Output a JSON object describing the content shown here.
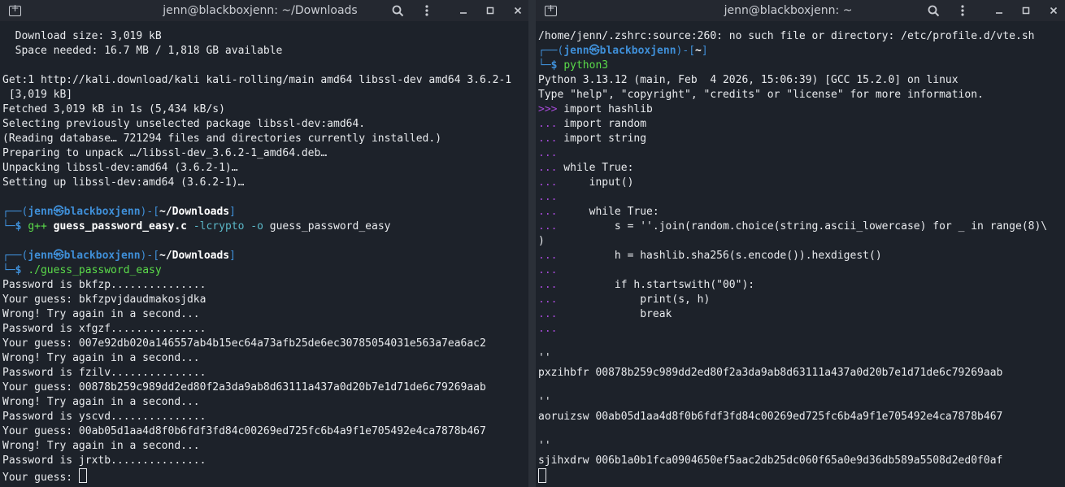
{
  "left_window": {
    "title": "jenn@blackboxjenn: ~/Downloads",
    "lines": [
      "  Download size: 3,019 kB",
      "  Space needed: 16.7 MB / 1,818 GB available",
      "",
      "Get:1 http://kali.download/kali kali-rolling/main amd64 libssl-dev amd64 3.6.2-1",
      " [3,019 kB]",
      "Fetched 3,019 kB in 1s (5,434 kB/s)",
      "Selecting previously unselected package libssl-dev:amd64.",
      "(Reading database… 721294 files and directories currently installed.)",
      "Preparing to unpack …/libssl-dev_3.6.2-1_amd64.deb…",
      "Unpacking libssl-dev:amd64 (3.6.2-1)…",
      "Setting up libssl-dev:amd64 (3.6.2-1)…"
    ],
    "prompt1": {
      "user": "jenn㉿blackboxjenn",
      "dir": "~/Downloads",
      "cmd": "g++",
      "file": "guess_password_easy.c",
      "opt1": "-lcrypto",
      "opt2": "-o",
      "out": "guess_password_easy"
    },
    "prompt2": {
      "user": "jenn㉿blackboxjenn",
      "dir": "~/Downloads",
      "cmd": "./guess_password_easy"
    },
    "output": [
      "Password is bkfzp...............",
      "Your guess: bkfzpvjdaudmakosjdka",
      "Wrong! Try again in a second...",
      "Password is xfgzf...............",
      "Your guess: 007e92db020a146557ab4b15ec64a73afb25de6ec30785054031e563a7ea6ac2",
      "Wrong! Try again in a second...",
      "Password is fzilv...............",
      "Your guess: 00878b259c989dd2ed80f2a3da9ab8d63111a437a0d20b7e1d71de6c79269aab",
      "Wrong! Try again in a second...",
      "Password is yscvd...............",
      "Your guess: 00ab05d1aa4d8f0b6fdf3fd84c00269ed725fc6b4a9f1e705492e4ca7878b467",
      "Wrong! Try again in a second...",
      "Password is jrxtb...............",
      "Your guess: "
    ]
  },
  "right_window": {
    "title": "jenn@blackboxjenn: ~",
    "error_line": "/home/jenn/.zshrc:source:260: no such file or directory: /etc/profile.d/vte.sh",
    "prompt": {
      "user": "jenn㉿blackboxjenn",
      "dir": "~",
      "cmd": "python3"
    },
    "banner1": "Python 3.13.12 (main, Feb  4 2026, 15:06:39) [GCC 15.2.0] on linux",
    "banner2": "Type \"help\", \"copyright\", \"credits\" or \"license\" for more information.",
    "code": [
      {
        "p": ">>>",
        "t": " import hashlib"
      },
      {
        "p": "...",
        "t": " import random"
      },
      {
        "p": "...",
        "t": " import string"
      },
      {
        "p": "...",
        "t": ""
      },
      {
        "p": "...",
        "t": " while True:"
      },
      {
        "p": "...",
        "t": "     input()"
      },
      {
        "p": "...",
        "t": ""
      },
      {
        "p": "...",
        "t": "     while True:"
      },
      {
        "p": "...",
        "t": "         s = ''.join(random.choice(string.ascii_lowercase) for _ in range(8)\\"
      },
      {
        "p": "",
        "t": ")"
      },
      {
        "p": "...",
        "t": "         h = hashlib.sha256(s.encode()).hexdigest()"
      },
      {
        "p": "...",
        "t": ""
      },
      {
        "p": "...",
        "t": "         if h.startswith(\"00\"):"
      },
      {
        "p": "...",
        "t": "             print(s, h)"
      },
      {
        "p": "...",
        "t": "             break"
      },
      {
        "p": "...",
        "t": ""
      },
      {
        "p": "",
        "t": ""
      },
      {
        "p": "",
        "t": "''"
      },
      {
        "p": "",
        "t": "pxzihbfr 00878b259c989dd2ed80f2a3da9ab8d63111a437a0d20b7e1d71de6c79269aab"
      },
      {
        "p": "",
        "t": ""
      },
      {
        "p": "",
        "t": "''"
      },
      {
        "p": "",
        "t": "aoruizsw 00ab05d1aa4d8f0b6fdf3fd84c00269ed725fc6b4a9f1e705492e4ca7878b467"
      },
      {
        "p": "",
        "t": ""
      },
      {
        "p": "",
        "t": "''"
      },
      {
        "p": "",
        "t": "sjihxdrw 006b1a0b1fca0904650ef5aac2db25dc060f65a0e9d36db589a5508d2ed0f0af"
      }
    ]
  }
}
